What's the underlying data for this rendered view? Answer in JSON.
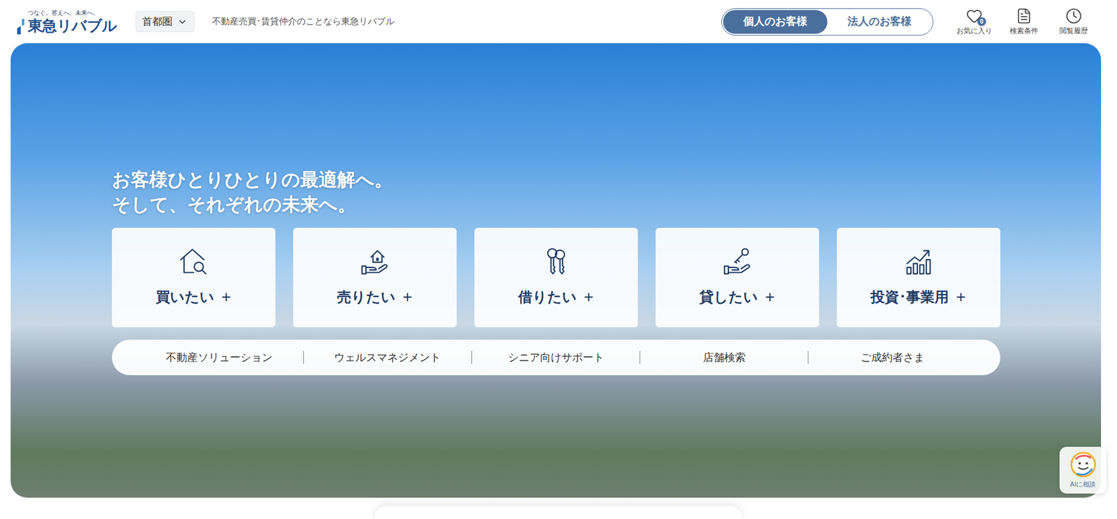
{
  "header": {
    "logo": {
      "tagline": "つなぐ。答えへ。未来へ。",
      "name": "東急リバブル"
    },
    "region": {
      "label": "首都圏"
    },
    "tagline": "不動産売買･賃貸仲介のことなら東急リバブル",
    "audience_tabs": [
      {
        "label": "個人のお客様",
        "selected": true
      },
      {
        "label": "法人のお客様",
        "selected": false
      }
    ],
    "icons": [
      {
        "label": "お気に入り",
        "badge": "0"
      },
      {
        "label": "検索条件"
      },
      {
        "label": "閲覧履歴"
      }
    ]
  },
  "hero": {
    "headline": [
      "お客様ひとりひとりの最適解へ。",
      "そして、それぞれの未来へ。"
    ],
    "cards": [
      {
        "label": "買いたい",
        "plus": "+"
      },
      {
        "label": "売りたい",
        "plus": "+"
      },
      {
        "label": "借りたい",
        "plus": "+"
      },
      {
        "label": "貸したい",
        "plus": "+"
      },
      {
        "label": "投資･事業用",
        "plus": "+"
      }
    ],
    "links": [
      "不動産ソリューション",
      "ウェルスマネジメント",
      "シニア向けサポート",
      "店舗検索",
      "ご成約者さま"
    ]
  },
  "ai_button": {
    "label": "AIに相談"
  }
}
